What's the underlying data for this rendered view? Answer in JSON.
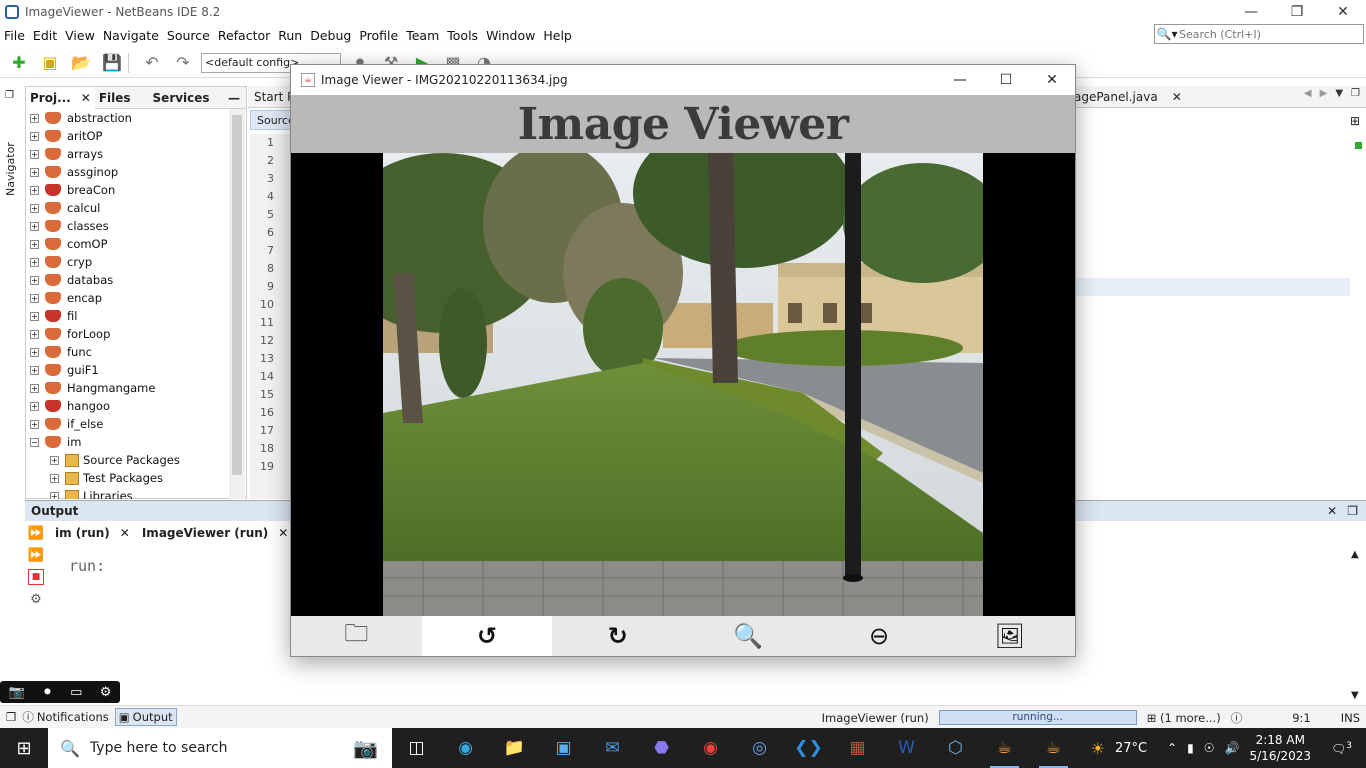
{
  "window": {
    "title": "ImageViewer - NetBeans IDE 8.2"
  },
  "menu": [
    "File",
    "Edit",
    "View",
    "Navigate",
    "Source",
    "Refactor",
    "Run",
    "Debug",
    "Profile",
    "Team",
    "Tools",
    "Window",
    "Help"
  ],
  "search": {
    "placeholder": "Search (Ctrl+I)"
  },
  "toolbar": {
    "config": "<default config>"
  },
  "navigator": {
    "label": "Navigator"
  },
  "projects_panel": {
    "tabs": [
      "Proj...",
      "Files",
      "Services"
    ],
    "projects": [
      {
        "name": "abstraction",
        "error": false
      },
      {
        "name": "aritOP",
        "error": false
      },
      {
        "name": "arrays",
        "error": false
      },
      {
        "name": "assginop",
        "error": false
      },
      {
        "name": "breaCon",
        "error": true
      },
      {
        "name": "calcul",
        "error": false
      },
      {
        "name": "classes",
        "error": false
      },
      {
        "name": "comOP",
        "error": false
      },
      {
        "name": "cryp",
        "error": false
      },
      {
        "name": "databas",
        "error": false
      },
      {
        "name": "encap",
        "error": false
      },
      {
        "name": "fil",
        "error": true
      },
      {
        "name": "forLoop",
        "error": false
      },
      {
        "name": "func",
        "error": false
      },
      {
        "name": "guiF1",
        "error": false
      },
      {
        "name": "Hangmangame",
        "error": false
      },
      {
        "name": "hangoo",
        "error": true
      },
      {
        "name": "if_else",
        "error": false
      },
      {
        "name": "im",
        "error": false
      }
    ],
    "children": [
      "Source Packages",
      "Test Packages",
      "Libraries"
    ]
  },
  "editor": {
    "tabs": {
      "start": "Start P",
      "image_panel": "agePanel.java"
    },
    "source_label": "Source",
    "line_numbers": [
      "1",
      "2",
      "3",
      "4",
      "5",
      "6",
      "7",
      "8",
      "9",
      "10",
      "11",
      "12",
      "13",
      "14",
      "15",
      "16",
      "17",
      "18",
      "19"
    ]
  },
  "output": {
    "title": "Output",
    "tabs": [
      "im (run)",
      "ImageViewer (run)"
    ],
    "text": "run:"
  },
  "statusbar": {
    "notifications": "Notifications",
    "output": "Output",
    "task": "ImageViewer (run)",
    "progress_text": "running...",
    "more": "(1 more...)",
    "position": "9:1",
    "mode": "INS"
  },
  "taskbar": {
    "search_placeholder": "Type here to search",
    "temperature": "27°C",
    "time": "2:18 AM",
    "date": "5/16/2023",
    "notification_count": "3"
  },
  "image_viewer": {
    "window_title": "Image Viewer - IMG20210220113634.jpg",
    "heading": "Image Viewer",
    "tools": [
      "open-folder-icon",
      "rotate-left-icon",
      "rotate-right-icon",
      "zoom-in-icon",
      "zoom-out-icon",
      "gallery-icon"
    ]
  },
  "colors": {
    "header_bg": "#b9b9b9",
    "heading_text": "#3b3b3b",
    "output_header": "#dbe6f3",
    "taskbar": "#1f1f1f"
  }
}
